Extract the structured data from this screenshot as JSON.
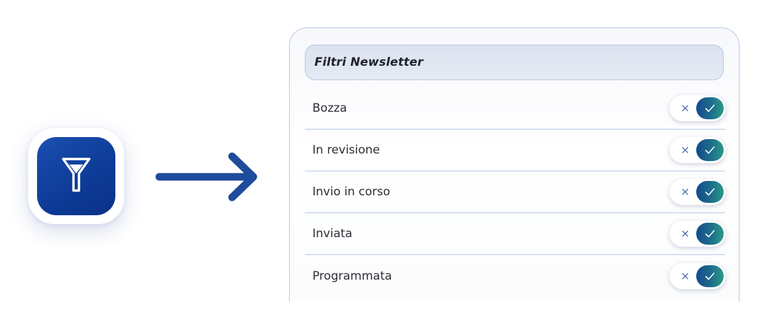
{
  "panel": {
    "title": "Filtri Newsletter",
    "filters": [
      {
        "label": "Bozza",
        "enabled": true
      },
      {
        "label": "In revisione",
        "enabled": true
      },
      {
        "label": "Invio in corso",
        "enabled": true
      },
      {
        "label": "Inviata",
        "enabled": true
      },
      {
        "label": "Programmata",
        "enabled": true
      }
    ],
    "toggle_off_glyph": "×"
  },
  "icons": {
    "filter_button": "filter-funnel-icon",
    "arrow": "arrow-right-icon",
    "toggle_check": "checkmark-icon"
  },
  "colors": {
    "filter_tile": "#0d3a96",
    "arrow": "#1e4b9b",
    "toggle_on_start": "#144a8c",
    "toggle_on_end": "#2a9a88",
    "divider": "#b8c6e6"
  }
}
